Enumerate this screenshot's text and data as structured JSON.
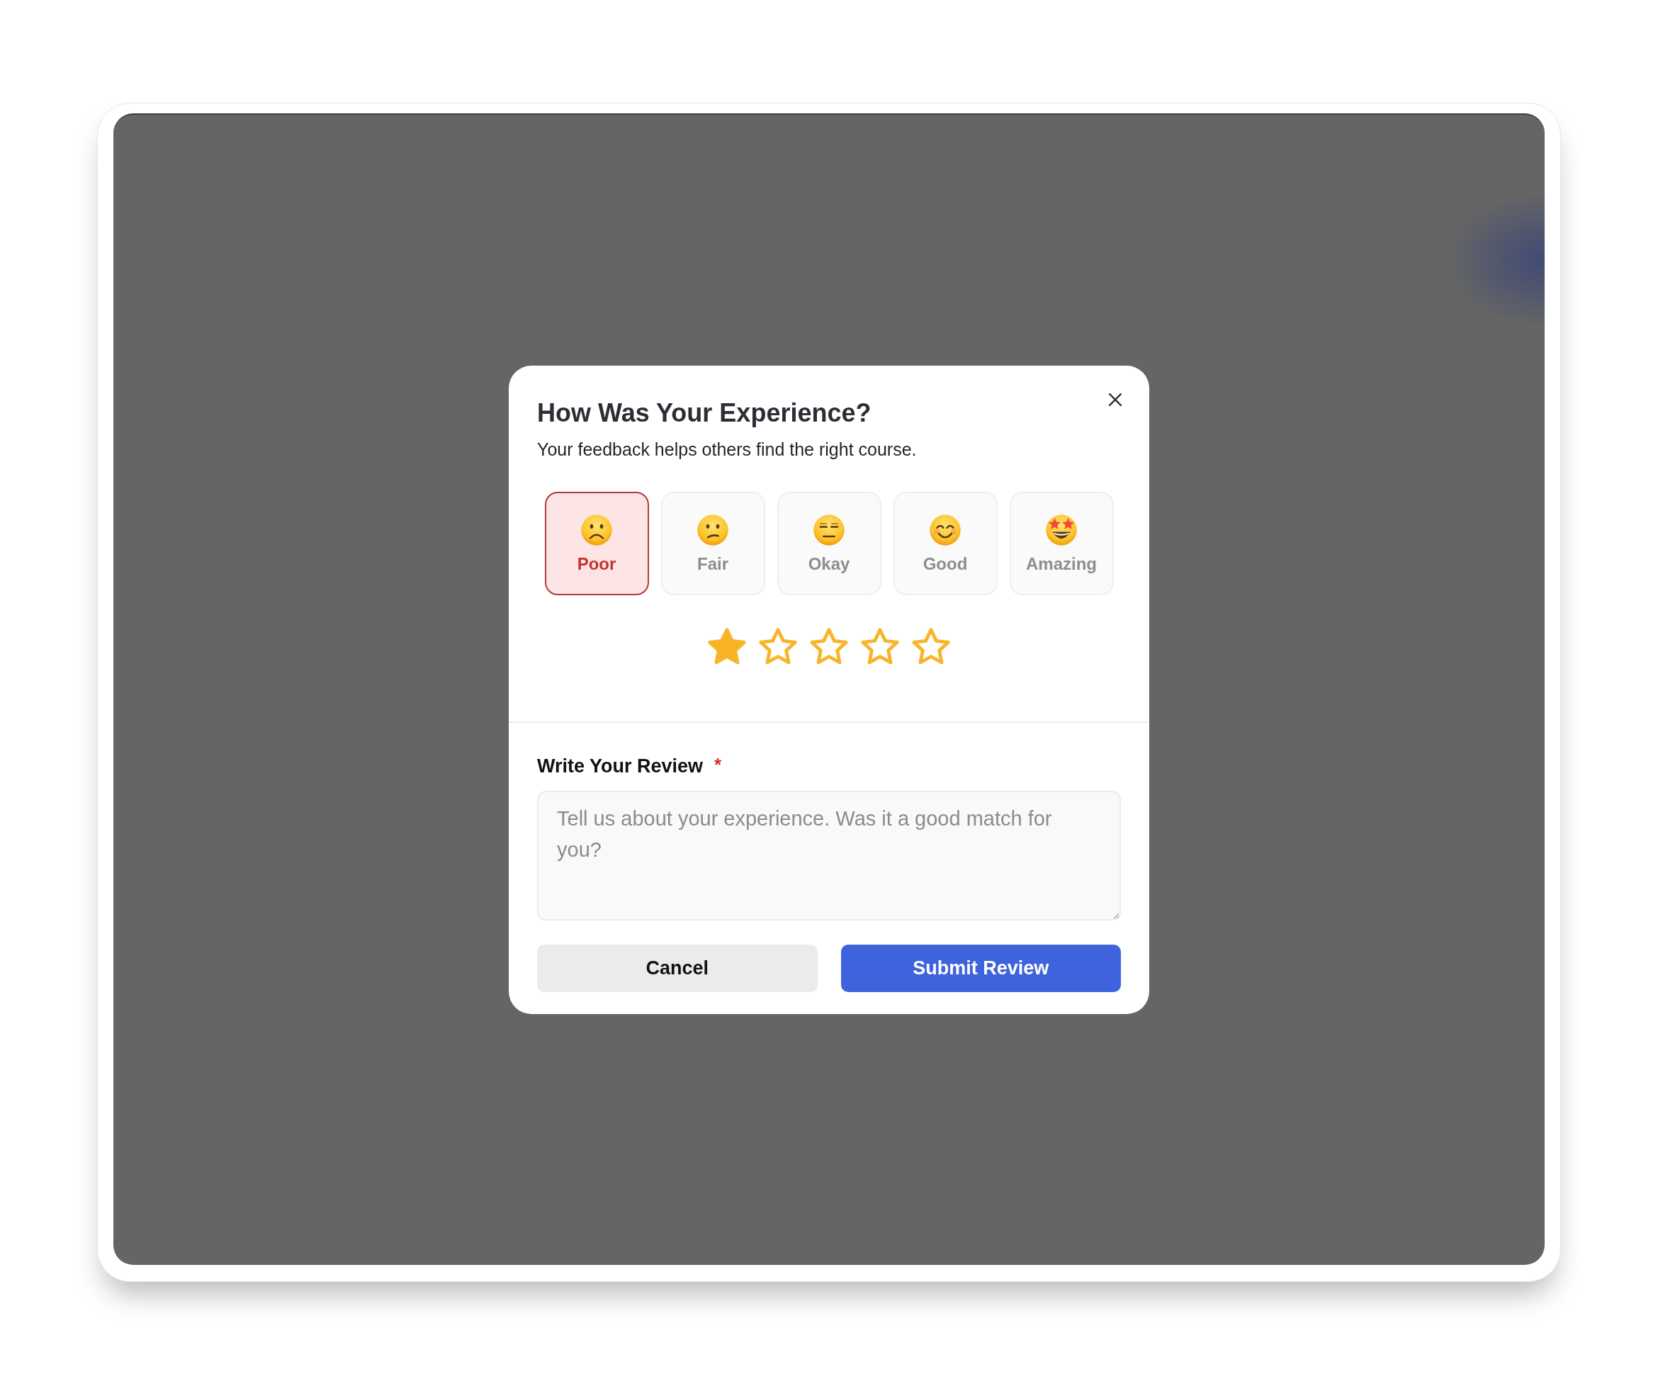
{
  "dialog": {
    "title": "How Was Your Experience?",
    "subtitle": "Your feedback helps others find the right course."
  },
  "moods": [
    {
      "label": "Poor",
      "kind": "frown",
      "selected": true
    },
    {
      "label": "Fair",
      "kind": "confused",
      "selected": false
    },
    {
      "label": "Okay",
      "kind": "flat",
      "selected": false
    },
    {
      "label": "Good",
      "kind": "smile",
      "selected": false
    },
    {
      "label": "Amazing",
      "kind": "starstruck",
      "selected": false
    }
  ],
  "rating": {
    "stars": 1
  },
  "review": {
    "label": "Write Your Review",
    "required_mark": "*",
    "placeholder": "Tell us about your experience. Was it a good match for you?"
  },
  "buttons": [
    {
      "label": "Cancel",
      "kind": "secondary"
    },
    {
      "label": "Submit Review",
      "kind": "primary"
    }
  ]
}
